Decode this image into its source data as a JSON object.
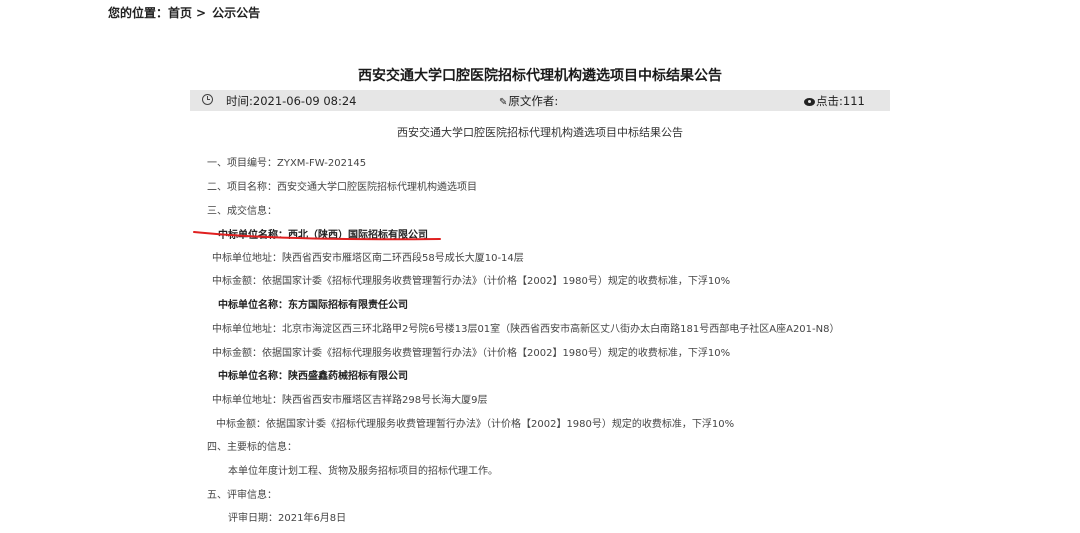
{
  "breadcrumb": {
    "label": "您的位置：",
    "home": "首页",
    "separator": ">",
    "current": "公示公告"
  },
  "article": {
    "title": "西安交通大学口腔医院招标代理机构遴选项目中标结果公告",
    "meta": {
      "time": "时间:2021-06-09 08:24",
      "author": "原文作者:",
      "clicks": "点击:111"
    },
    "subtitle": "西安交通大学口腔医院招标代理机构遴选项目中标结果公告",
    "lines": [
      "一、项目编号：ZYXM-FW-202145",
      "二、项目名称：西安交通大学口腔医院招标代理机构遴选项目",
      "三、成交信息：",
      "中标单位名称：西北（陕西）国际招标有限公司",
      "中标单位地址：陕西省西安市雁塔区南二环西段58号成长大厦10-14层",
      "中标金额：依据国家计委《招标代理服务收费管理暂行办法》（计价格【2002】1980号）规定的收费标准，下浮10%",
      "中标单位名称：东方国际招标有限责任公司",
      "中标单位地址：北京市海淀区西三环北路甲2号院6号楼13层01室（陕西省西安市高新区丈八街办太白南路181号西部电子社区A座A201-N8）",
      "中标金额：依据国家计委《招标代理服务收费管理暂行办法》（计价格【2002】1980号）规定的收费标准，下浮10%",
      "中标单位名称：陕西盛鑫药械招标有限公司",
      "中标单位地址：陕西省西安市雁塔区吉祥路298号长海大厦9层",
      "中标金额：依据国家计委《招标代理服务收费管理暂行办法》（计价格【2002】1980号）规定的收费标准，下浮10%",
      "四、主要标的信息：",
      "本单位年度计划工程、货物及服务招标项目的招标代理工作。",
      "五、评审信息：",
      "评审日期：2021年6月8日"
    ]
  },
  "colors": {
    "meta_bar": "#e6e6e6",
    "underline_mark": "#e02020"
  }
}
